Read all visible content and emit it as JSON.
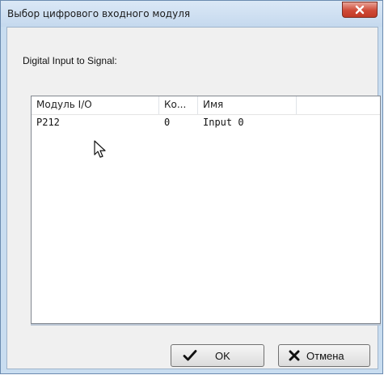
{
  "window": {
    "title": "Выбор цифрового входного модуля"
  },
  "section_label": "Digital Input to Signal:",
  "list": {
    "columns": [
      "Модуль I/O",
      "Ко...",
      "Имя"
    ],
    "rows": [
      {
        "module": "P212",
        "channel": "0",
        "name": "Input 0"
      }
    ]
  },
  "buttons": {
    "ok": "OK",
    "cancel": "Отмена"
  },
  "icons": {
    "close": "close-icon",
    "ok": "checkmark-icon",
    "cancel": "cross-icon",
    "cursor": "mouse-pointer-icon"
  },
  "colors": {
    "title_bar": "#c5d9ee",
    "close_button": "#cf4a37",
    "dialog_bg": "#f0f0f0"
  }
}
